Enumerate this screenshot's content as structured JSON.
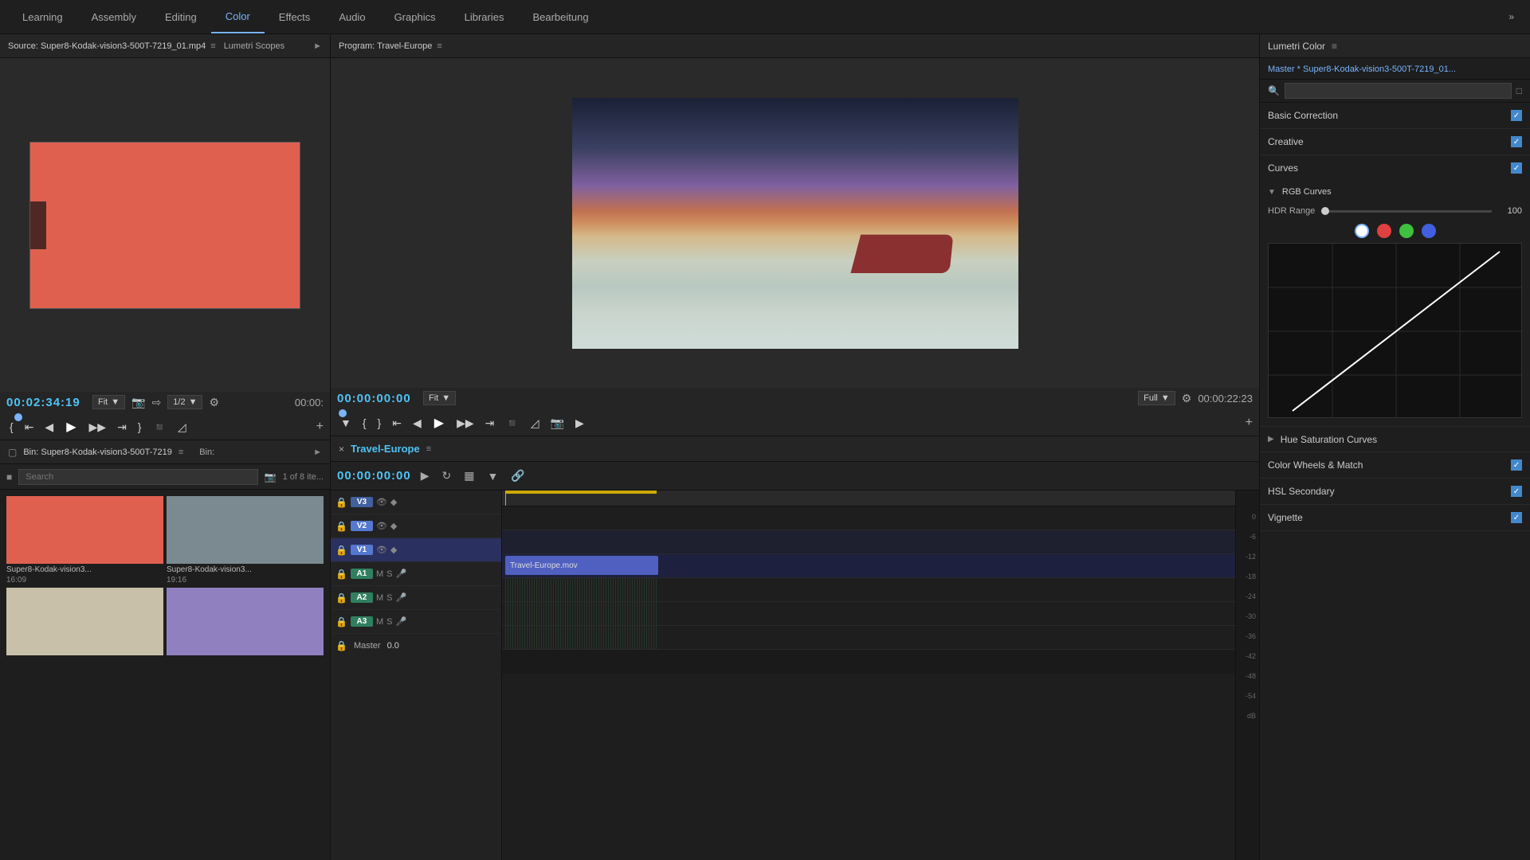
{
  "nav": {
    "items": [
      "Learning",
      "Assembly",
      "Editing",
      "Color",
      "Effects",
      "Audio",
      "Graphics",
      "Libraries",
      "Bearbeitung"
    ],
    "active": "Color"
  },
  "source_monitor": {
    "title": "Source: Super8-Kodak-vision3-500T-7219_01.mp4",
    "scopes": "Lumetri Scopes",
    "timecode": "00:02:34:19",
    "timecode_right": "00:00:",
    "fit": "Fit",
    "quality": "1/2"
  },
  "program_monitor": {
    "title": "Program: Travel-Europe",
    "timecode": "00:00:00:00",
    "timecode_right": "00:00:22:23",
    "fit": "Fit",
    "quality": "Full"
  },
  "bin": {
    "title": "Bin: Super8-Kodak-vision3-500T-7219",
    "bin_label": "Bin:",
    "count": "1 of 8 ite...",
    "items": [
      {
        "name": "Super8-Kodak-vision3...",
        "duration": "16:09",
        "color": "red"
      },
      {
        "name": "Super8-Kodak-vision3...",
        "duration": "19:16",
        "color": "gray"
      },
      {
        "name": "",
        "duration": "",
        "color": "light"
      },
      {
        "name": "",
        "duration": "",
        "color": "purple"
      }
    ]
  },
  "timeline": {
    "title": "Travel-Europe",
    "timecode": "00:00:00:00",
    "tracks": [
      {
        "label": "V3",
        "type": "video"
      },
      {
        "label": "V2",
        "type": "video"
      },
      {
        "label": "V1",
        "type": "video",
        "active": true
      },
      {
        "label": "A1",
        "type": "audio"
      },
      {
        "label": "A2",
        "type": "audio"
      },
      {
        "label": "A3",
        "type": "audio"
      }
    ],
    "master_label": "Master",
    "master_val": "0.0",
    "clip_name": "Travel-Europe.mov"
  },
  "lumetri": {
    "title": "Lumetri Color",
    "clip_name": "Master * Super8-Kodak-vision3-500T-7219_01...",
    "sections": {
      "basic_correction": {
        "label": "Basic Correction",
        "enabled": true
      },
      "creative": {
        "label": "Creative",
        "enabled": true
      },
      "curves": {
        "label": "Curves",
        "enabled": true
      },
      "rgb_curves": {
        "label": "RGB Curves",
        "hdr_range_label": "HDR Range",
        "hdr_value": "100"
      },
      "hue_saturation": {
        "label": "Hue Saturation Curves"
      },
      "color_wheels": {
        "label": "Color Wheels & Match",
        "enabled": true
      },
      "hsl_secondary": {
        "label": "HSL Secondary",
        "enabled": true
      },
      "vignette": {
        "label": "Vignette",
        "enabled": true
      }
    },
    "color_dots": [
      "white",
      "red",
      "green",
      "blue"
    ]
  },
  "scale_labels": [
    "0",
    "-6",
    "-12",
    "-18",
    "-24",
    "-30",
    "-36",
    "-42",
    "-48",
    "-54",
    "dB"
  ]
}
